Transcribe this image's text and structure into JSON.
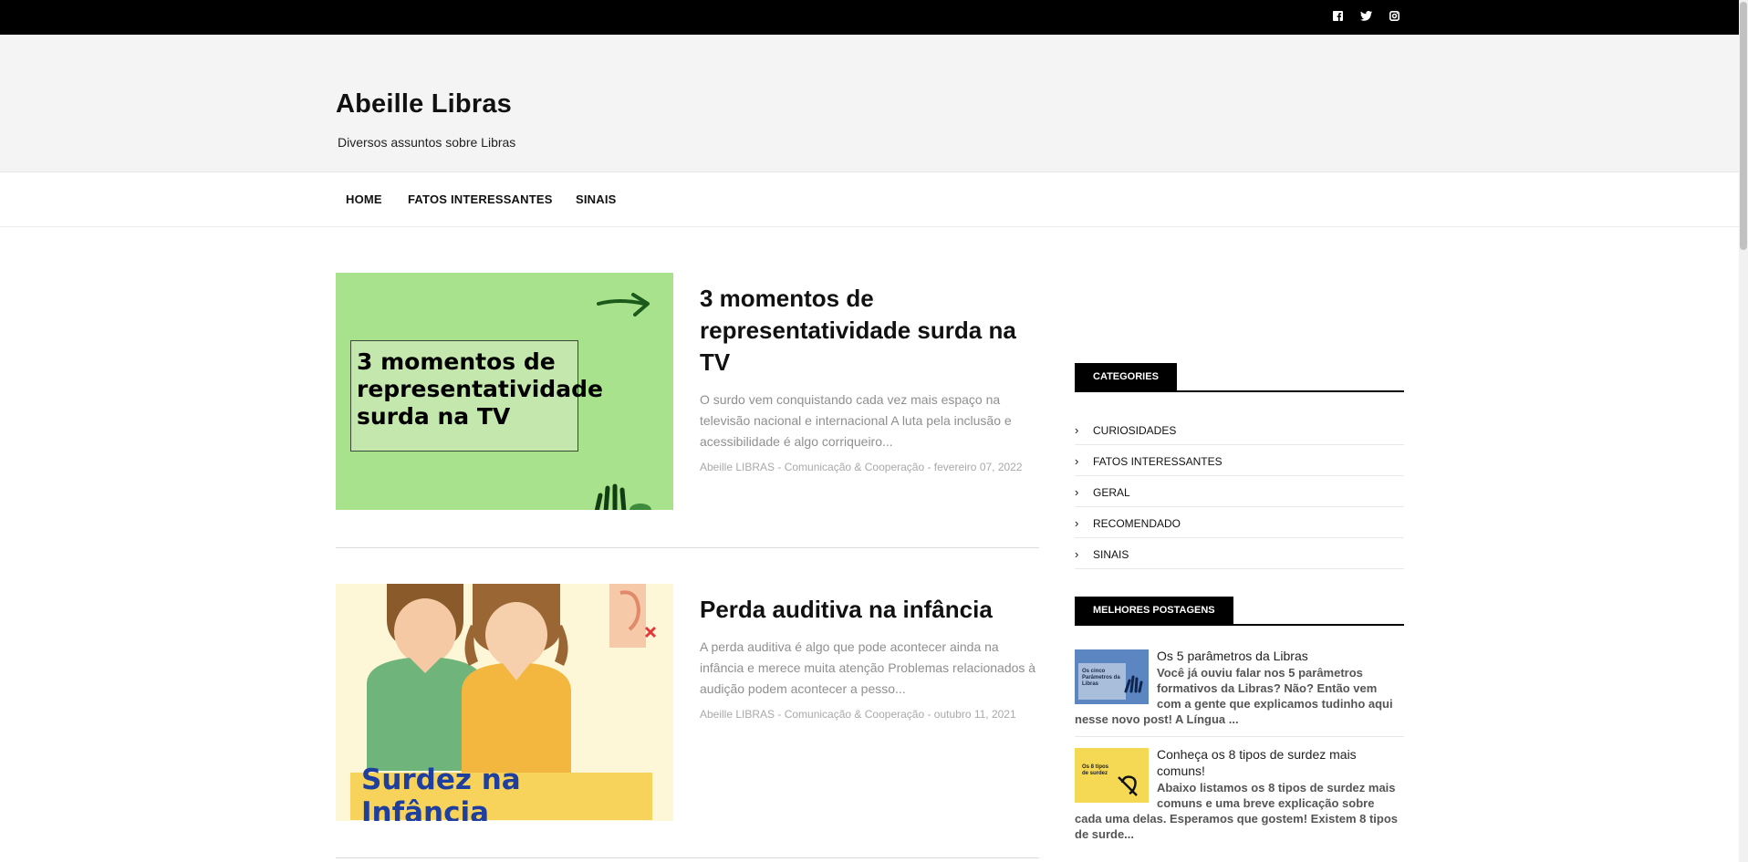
{
  "site": {
    "title": "Abeille Libras",
    "description": "Diversos assuntos sobre Libras"
  },
  "topbar": {
    "social_icons": [
      "facebook-icon",
      "twitter-icon",
      "instagram-icon"
    ]
  },
  "nav": {
    "items": [
      "HOME",
      "FATOS INTERESSANTES",
      "SINAIS"
    ]
  },
  "posts": [
    {
      "title": "3 momentos de representatividade surda na TV",
      "thumb_text": [
        "3 momentos de",
        "representatividade",
        "surda na TV"
      ],
      "excerpt": "O surdo vem conquistando cada vez mais espaço na televisão nacional e internacional A luta pela inclusão e acessibilidade é algo corriqueiro...",
      "meta": "Abeille LIBRAS - Comunicação & Cooperação - fevereiro 07, 2022"
    },
    {
      "title": "Perda auditiva na infância",
      "thumb_text": "Surdez na Infância",
      "excerpt": "A perda auditiva é algo que pode acontecer ainda na infância e merece muita atenção Problemas relacionados à audição podem acontecer a pesso...",
      "meta": "Abeille LIBRAS - Comunicação & Cooperação - outubro 11, 2021"
    }
  ],
  "sidebar": {
    "categories": {
      "heading": "CATEGORIES",
      "items": [
        "CURIOSIDADES",
        "FATOS INTERESSANTES",
        "GERAL",
        "RECOMENDADO",
        "SINAIS"
      ]
    },
    "best_posts": {
      "heading": "MELHORES POSTAGENS",
      "items": [
        {
          "title": "Os 5 parâmetros da Libras",
          "thumb_text": "Os cinco Parâmetros da Libras",
          "snippet": "Você já ouviu falar nos 5 parâmetros formativos da Libras? Não? Então vem com a gente que explicamos tudinho aqui nesse novo post! A Língua ..."
        },
        {
          "title": "Conheça os 8 tipos de surdez mais comuns!",
          "thumb_text": "Os 8 tipos de surdez",
          "snippet": "Abaixo listamos os 8 tipos de surdez mais comuns e uma breve explicação sobre cada uma delas. Esperamos que gostem! Existem 8 tipos de surde..."
        }
      ]
    }
  },
  "colors": {
    "topbar": "#000000",
    "header_bg": "#f4f4f4",
    "widget_head": "#000000",
    "thumb1_bg": "#a9e28c",
    "thumb2_bg": "#fef7d7"
  }
}
